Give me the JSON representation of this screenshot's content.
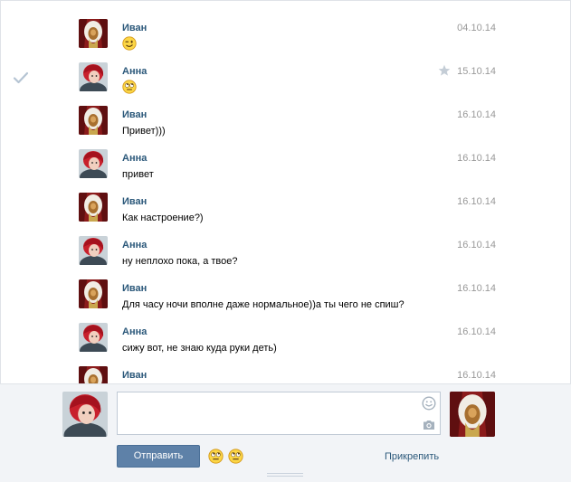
{
  "messages": [
    {
      "author": "Иван",
      "text": "",
      "emoji": "wink",
      "date": "04.10.14",
      "role": "ivan",
      "checked": false,
      "starred": false
    },
    {
      "author": "Анна",
      "text": "",
      "emoji": "rolleyes",
      "date": "15.10.14",
      "role": "anna",
      "checked": true,
      "starred": true
    },
    {
      "author": "Иван",
      "text": "Привет)))",
      "emoji": null,
      "date": "16.10.14",
      "role": "ivan",
      "checked": false,
      "starred": false
    },
    {
      "author": "Анна",
      "text": "привет",
      "emoji": null,
      "date": "16.10.14",
      "role": "anna",
      "checked": false,
      "starred": false
    },
    {
      "author": "Иван",
      "text": "Как настроение?)",
      "emoji": null,
      "date": "16.10.14",
      "role": "ivan",
      "checked": false,
      "starred": false
    },
    {
      "author": "Анна",
      "text": "ну неплохо пока, а твое?",
      "emoji": null,
      "date": "16.10.14",
      "role": "anna",
      "checked": false,
      "starred": false
    },
    {
      "author": "Иван",
      "text": "Для часу ночи вполне даже нормальное))а ты чего не спиш?",
      "emoji": null,
      "date": "16.10.14",
      "role": "ivan",
      "checked": false,
      "starred": false
    },
    {
      "author": "Анна",
      "text": "сижу вот, не знаю куда руки деть)",
      "emoji": null,
      "date": "16.10.14",
      "role": "anna",
      "checked": false,
      "starred": false
    },
    {
      "author": "Иван",
      "text": "",
      "emoji": null,
      "date": "16.10.14",
      "role": "ivan",
      "checked": false,
      "starred": false
    }
  ],
  "composer": {
    "text_value": "",
    "send_label": "Отправить",
    "attach_label": "Прикрепить",
    "quick_emojis": [
      "rolleyes",
      "rolleyes"
    ]
  },
  "icons": {
    "check": "check-icon",
    "star": "star-icon",
    "emoji_picker": "smiley-icon",
    "camera": "camera-icon"
  },
  "colors": {
    "author": "#2b587a",
    "date": "#999999",
    "send_button": "#5e81a8",
    "composer_background": "#f2f4f7"
  }
}
